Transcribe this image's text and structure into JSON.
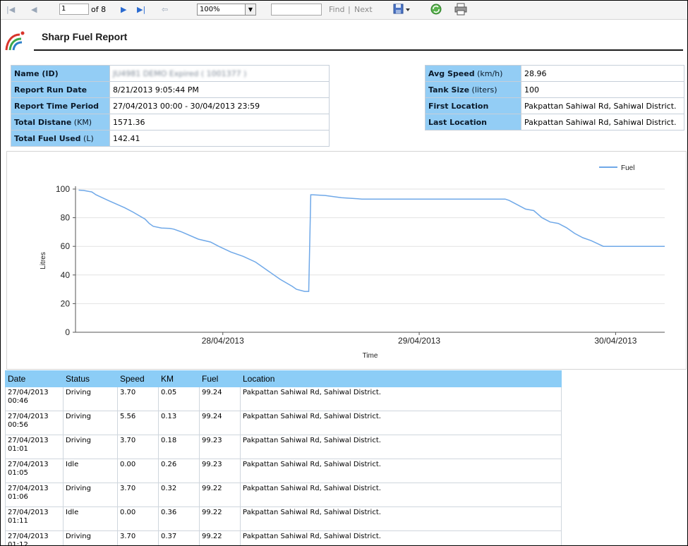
{
  "toolbar": {
    "page_number": "1",
    "page_of": "of 8",
    "zoom": "100%",
    "find_label": "Find",
    "find_separator": "|",
    "next_label": "Next"
  },
  "report": {
    "title": "Sharp Fuel Report"
  },
  "info_left": [
    {
      "key": "Name (ID)",
      "unit": "",
      "value": "JU4981 DEMO Expired ( 1001377 )",
      "blurred": true
    },
    {
      "key": "Report Run Date",
      "unit": "",
      "value": "8/21/2013 9:05:44 PM"
    },
    {
      "key": "Report Time Period",
      "unit": "",
      "value": "27/04/2013 00:00 - 30/04/2013 23:59"
    },
    {
      "key": "Total Distane",
      "unit": " (KM)",
      "value": "1571.36"
    },
    {
      "key": "Total Fuel Used",
      "unit": " (L)",
      "value": "142.41"
    }
  ],
  "info_right": [
    {
      "key": "Avg Speed",
      "unit": " (km/h)",
      "value": "28.96"
    },
    {
      "key": "Tank Size",
      "unit": " (liters)",
      "value": "100"
    },
    {
      "key": "First Location",
      "unit": "",
      "value": "Pakpattan Sahiwal Rd, Sahiwal District."
    },
    {
      "key": "Last Location",
      "unit": "",
      "value": "Pakpattan Sahiwal Rd, Sahiwal District."
    }
  ],
  "chart_data": {
    "type": "line",
    "xlabel": "Time",
    "ylabel": "Litres",
    "ylim": [
      0,
      100
    ],
    "yticks": [
      0,
      20,
      40,
      60,
      80,
      100
    ],
    "xticks": [
      "28/04/2013",
      "29/04/2013",
      "30/04/2013"
    ],
    "grid": true,
    "legend_position": "top-right",
    "series": [
      {
        "name": "Fuel",
        "color": "#6fa8e8",
        "x_unit": "hours since 27/04/2013 00:00",
        "x": [
          0.77,
          2,
          4,
          5,
          8,
          12,
          14,
          17,
          18,
          19,
          21,
          23,
          24,
          26,
          30,
          33,
          35,
          38,
          41,
          44,
          47,
          50,
          53,
          54,
          56,
          57,
          57.5,
          58,
          61,
          65,
          70,
          75,
          80,
          86,
          90,
          96,
          100,
          105,
          106,
          108,
          110,
          112,
          114,
          116,
          118,
          120,
          122,
          124,
          126,
          129,
          133,
          138,
          143,
          144
        ],
        "y": [
          99.24,
          99,
          98,
          96,
          92,
          87,
          84,
          79,
          76,
          74,
          72.8,
          72.5,
          72,
          70,
          65,
          63,
          60,
          56,
          53,
          49,
          43,
          37,
          32,
          30,
          28.5,
          28.5,
          96,
          96,
          95.5,
          94,
          93,
          93,
          93,
          93,
          93,
          93,
          93,
          93,
          92,
          89,
          86,
          85,
          80,
          77,
          76,
          73,
          69,
          66,
          64,
          60,
          60,
          60,
          60,
          60
        ]
      }
    ]
  },
  "table": {
    "headers": [
      "Date",
      "Status",
      "Speed",
      "KM",
      "Fuel",
      "Location"
    ],
    "rows": [
      {
        "date": "27/04/2013 00:46",
        "status": "Driving",
        "speed": "3.70",
        "km": "0.05",
        "fuel": "99.24",
        "location": "Pakpattan Sahiwal Rd, Sahiwal District."
      },
      {
        "date": "27/04/2013 00:56",
        "status": "Driving",
        "speed": "5.56",
        "km": "0.13",
        "fuel": "99.24",
        "location": "Pakpattan Sahiwal Rd, Sahiwal District."
      },
      {
        "date": "27/04/2013 01:01",
        "status": "Driving",
        "speed": "3.70",
        "km": "0.18",
        "fuel": "99.23",
        "location": "Pakpattan Sahiwal Rd, Sahiwal District."
      },
      {
        "date": "27/04/2013 01:05",
        "status": "Idle",
        "speed": "0.00",
        "km": "0.26",
        "fuel": "99.23",
        "location": "Pakpattan Sahiwal Rd, Sahiwal District."
      },
      {
        "date": "27/04/2013 01:06",
        "status": "Driving",
        "speed": "3.70",
        "km": "0.32",
        "fuel": "99.22",
        "location": "Pakpattan Sahiwal Rd, Sahiwal District."
      },
      {
        "date": "27/04/2013 01:11",
        "status": "Idle",
        "speed": "0.00",
        "km": "0.36",
        "fuel": "99.22",
        "location": "Pakpattan Sahiwal Rd, Sahiwal District."
      },
      {
        "date": "27/04/2013 01:12",
        "status": "Driving",
        "speed": "3.70",
        "km": "0.37",
        "fuel": "99.22",
        "location": "Pakpattan Sahiwal Rd, Sahiwal District."
      }
    ]
  },
  "colors": {
    "header_blue": "#93cdf5",
    "table_header_blue": "#8ccdf6",
    "line_blue": "#6fa8e8"
  },
  "icons": [
    "first-page-icon",
    "prev-page-icon",
    "next-page-icon",
    "last-page-icon",
    "back-icon",
    "export-icon",
    "refresh-icon",
    "print-icon",
    "logo-icon"
  ]
}
